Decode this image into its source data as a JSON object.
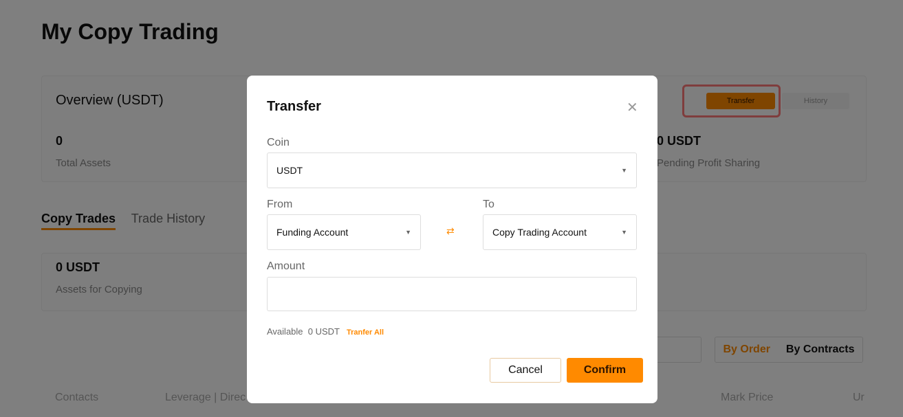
{
  "page": {
    "title": "My Copy Trading",
    "overview": {
      "title": "Overview (USDT)",
      "total_value": "0",
      "total_label": "Total Assets",
      "pending_value": "0 USDT",
      "pending_label": "Pending Profit Sharing",
      "transfer": "Transfer",
      "history": "History"
    },
    "tabs": [
      "Copy Trades",
      "Trade History"
    ],
    "copy": {
      "value": "0 USDT",
      "label": "Assets for Copying"
    },
    "segment": [
      "By Order",
      "By Contracts"
    ],
    "columns": [
      "Contacts",
      "Leverage | Direc",
      "Mark Price",
      "Ur"
    ]
  },
  "modal": {
    "title": "Transfer",
    "coin_label": "Coin",
    "coin": "USDT",
    "from_label": "From",
    "from": "Funding Account",
    "to_label": "To",
    "to": "Copy Trading Account",
    "amount_label": "Amount",
    "amount": "",
    "available_label": "Available",
    "available": "0 USDT",
    "transfer_all": "Tranfer All",
    "cancel": "Cancel",
    "confirm": "Confirm"
  },
  "colors": {
    "accent": "#ff8a00",
    "highlight": "#ff7b7b"
  }
}
